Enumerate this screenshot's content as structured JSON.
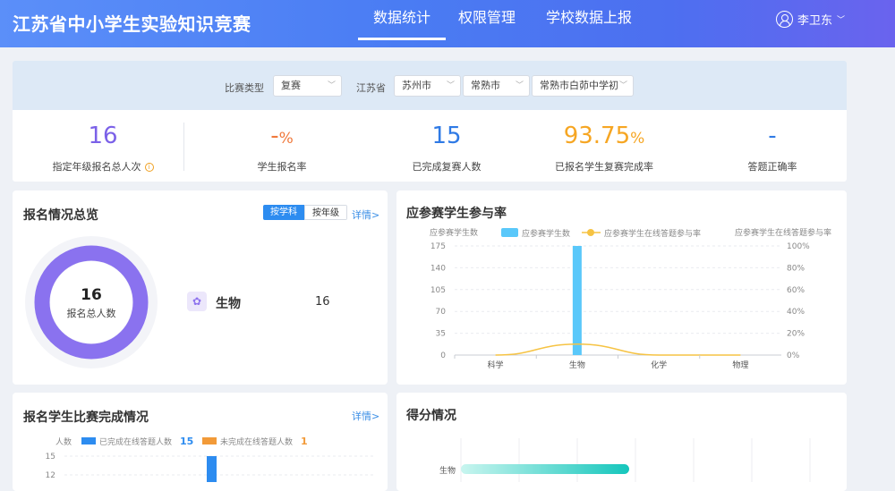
{
  "app": {
    "title": "江苏省中小学生实验知识竞赛"
  },
  "nav": [
    {
      "label": "数据统计",
      "active": true
    },
    {
      "label": "权限管理",
      "active": false
    },
    {
      "label": "学校数据上报",
      "active": false
    }
  ],
  "user": {
    "name": "李卫东",
    "icon": "user-circle-icon"
  },
  "filters": {
    "type_label": "比赛类型",
    "type_value": "复赛",
    "province_label": "江苏省",
    "city": "苏州市",
    "county": "常熟市",
    "school": "常熟市白茆中学初"
  },
  "stats": [
    {
      "value": "16",
      "unit": "",
      "label": "指定年级报名总人次",
      "color": "#7b61e8"
    },
    {
      "value": "-",
      "unit": "%",
      "label": "学生报名率",
      "color": "#f0793c"
    },
    {
      "value": "15",
      "unit": "",
      "label": "已完成复赛人数",
      "color": "#2f7ae5"
    },
    {
      "value": "93.75",
      "unit": "%",
      "label": "已报名学生复赛完成率",
      "color": "#f6a623"
    },
    {
      "value": "-",
      "unit": "",
      "label": "答题正确率",
      "color": "#2f7ae5"
    }
  ],
  "registration": {
    "title": "报名情况总览",
    "tab_subject": "按学科",
    "tab_grade": "按年级",
    "details": "详情>",
    "total": "16",
    "total_label": "报名总人数",
    "ring_color": "#8a72ef",
    "subject": {
      "name": "生物",
      "value": "16",
      "icon": "flower-icon"
    }
  },
  "participation": {
    "title": "应参赛学生参与率",
    "left_axis_label": "应参赛学生数",
    "right_axis_label": "应参赛学生在线答题参与率",
    "legend_bar": "应参赛学生数",
    "legend_line": "应参赛学生在线答题参与率"
  },
  "completion": {
    "title": "报名学生比赛完成情况",
    "details": "详情>",
    "y_label": "人数",
    "legend_done": "已完成在线答题人数",
    "done_count": "15",
    "legend_undone": "未完成在线答题人数",
    "undone_count": "1"
  },
  "score": {
    "title": "得分情况",
    "bar_label": "生物"
  },
  "chart_data": [
    {
      "type": "bar",
      "title": "应参赛学生参与率",
      "categories": [
        "科学",
        "生物",
        "化学",
        "物理"
      ],
      "ylim": [
        0,
        175
      ],
      "y2lim": [
        0,
        1
      ],
      "yticks": [
        "175",
        "140",
        "105",
        "70",
        "35",
        "0"
      ],
      "y2ticks": [
        "100%",
        "80%",
        "60%",
        "40%",
        "20%",
        "0%"
      ],
      "series": [
        {
          "name": "应参赛学生数",
          "type": "bar",
          "axis": "left",
          "values": [
            0,
            175,
            0,
            0
          ],
          "color": "#5ac8fa"
        },
        {
          "name": "应参赛学生在线答题参与率",
          "type": "line",
          "axis": "right",
          "values": [
            0,
            0.1,
            0,
            0
          ],
          "color": "#f6c343"
        }
      ],
      "grid": true,
      "legend": "top"
    },
    {
      "type": "bar",
      "title": "报名学生比赛完成情况",
      "yticks": [
        "15",
        "12"
      ],
      "series": [
        {
          "name": "已完成在线答题人数",
          "values": [
            15
          ],
          "color": "#2d8cf0"
        },
        {
          "name": "未完成在线答题人数",
          "values": [
            1
          ],
          "color": "#f29a38"
        }
      ]
    },
    {
      "type": "bar",
      "title": "得分情况",
      "categories": [
        "生物"
      ],
      "orientation": "horizontal",
      "color_from": "#c8f5ef",
      "color_to": "#15c6bc"
    }
  ]
}
